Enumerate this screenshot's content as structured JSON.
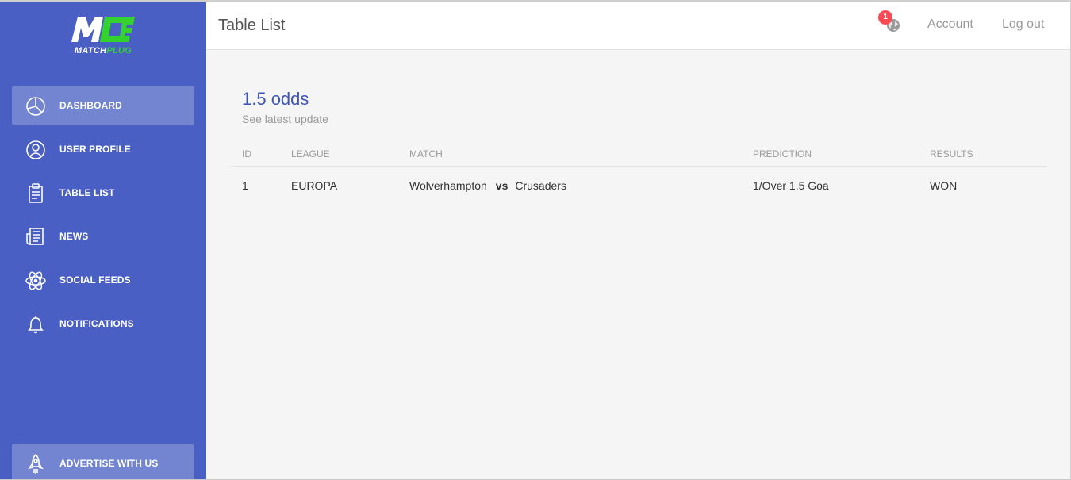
{
  "brand": {
    "name_part1": "MATCH",
    "name_part2": "PLUG",
    "accent_color": "#33d22f",
    "sidebar_color": "#4a5fc3"
  },
  "sidebar": {
    "items": [
      {
        "label": "DASHBOARD",
        "icon": "pie-chart-icon",
        "active": true
      },
      {
        "label": "USER PROFILE",
        "icon": "user-icon"
      },
      {
        "label": "TABLE LIST",
        "icon": "clipboard-icon"
      },
      {
        "label": "NEWS",
        "icon": "newspaper-icon"
      },
      {
        "label": "SOCIAL FEEDS",
        "icon": "atom-icon"
      },
      {
        "label": "NOTIFICATIONS",
        "icon": "bell-icon"
      }
    ],
    "advertise": {
      "label": "ADVERTISE WITH US",
      "icon": "rocket-icon"
    }
  },
  "header": {
    "title": "Table List",
    "notification_count": "1",
    "account_label": "Account",
    "logout_label": "Log out"
  },
  "content": {
    "title": "1.5 odds",
    "subtitle": "See latest update",
    "table": {
      "columns": [
        "ID",
        "LEAGUE",
        "MATCH",
        "PREDICTION",
        "RESULTS"
      ],
      "rows": [
        {
          "id": "1",
          "league": "EUROPA",
          "home": "Wolverhampton",
          "vs": "vs",
          "away": "Crusaders",
          "prediction": "1/Over 1.5 Goa",
          "result": "WON"
        }
      ]
    }
  }
}
